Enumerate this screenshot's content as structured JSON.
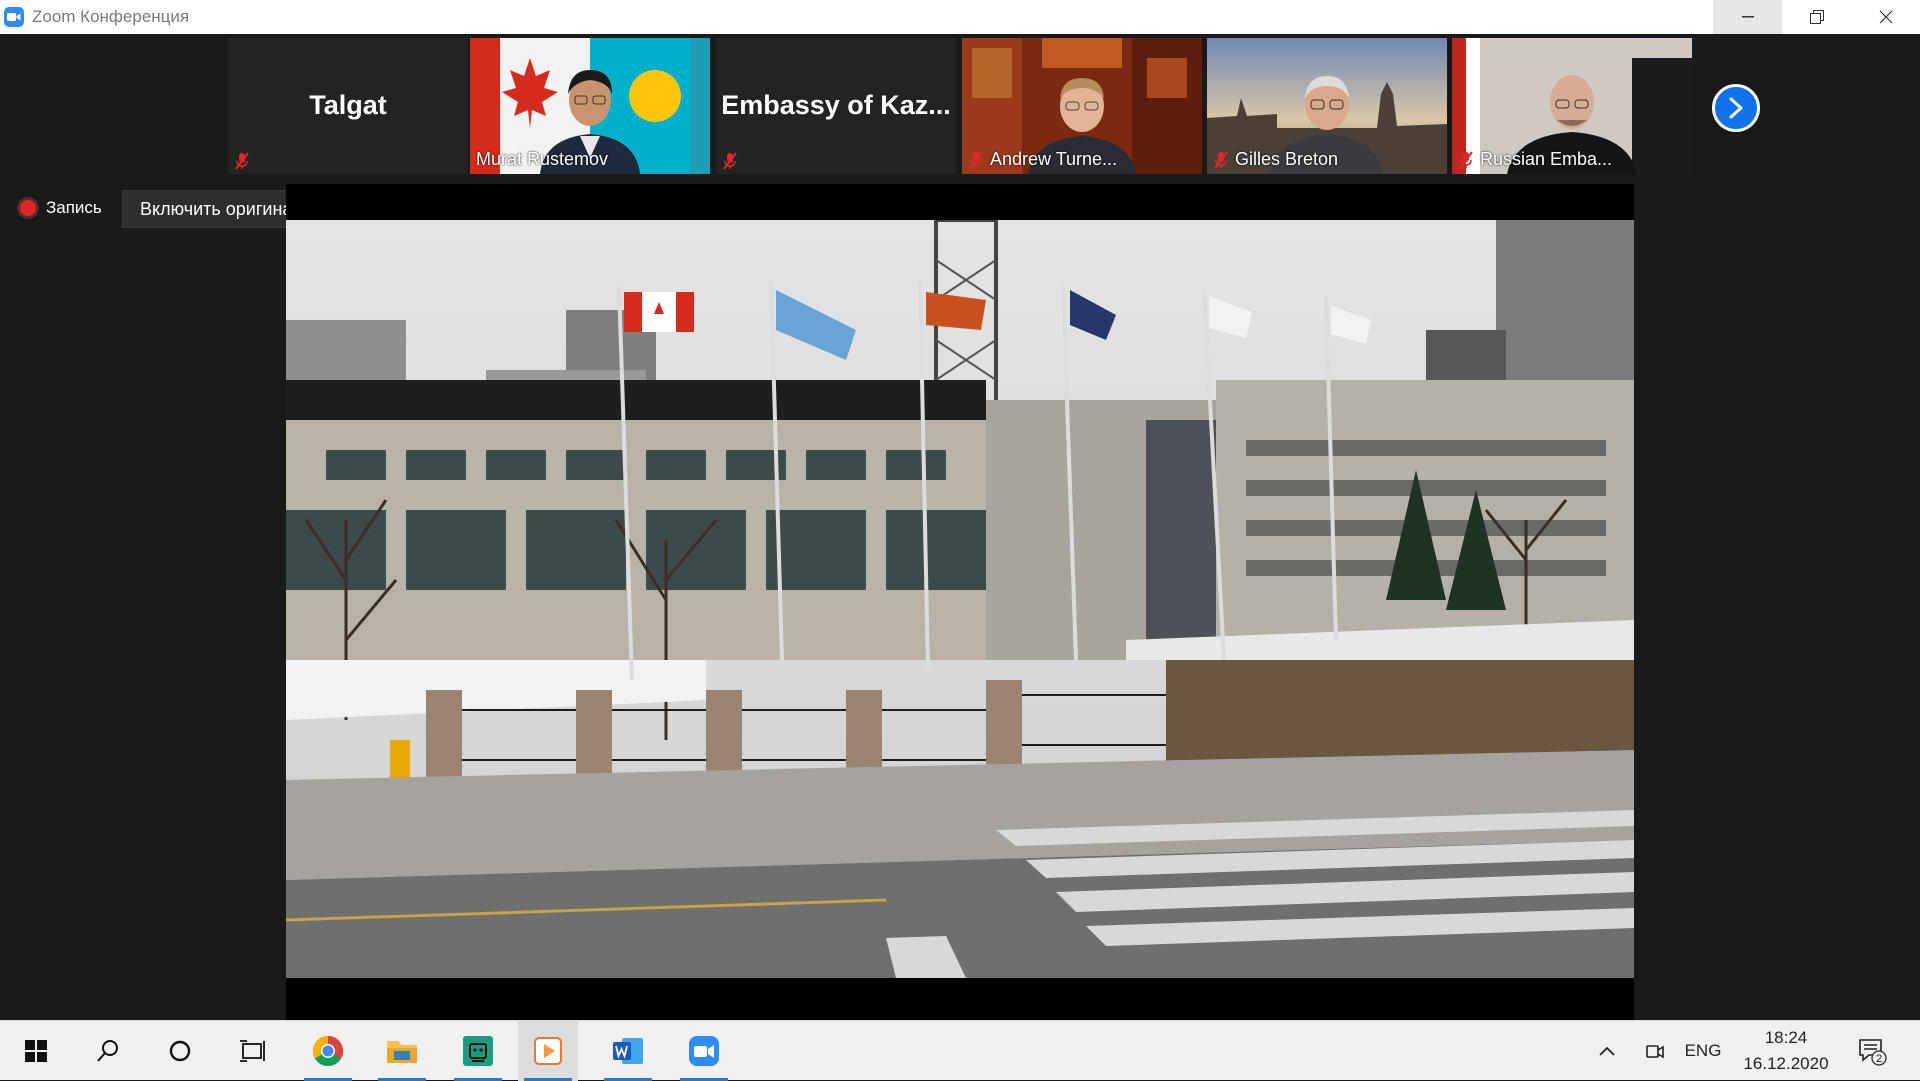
{
  "window": {
    "title": "Zoom Конференция"
  },
  "participants": [
    {
      "name": "Talgat",
      "display": "name",
      "muted": true
    },
    {
      "name": "Murat Rustemov",
      "display": "video",
      "muted": false,
      "active_speaker": true
    },
    {
      "name": "Embassy  of  Kaz...",
      "display": "name",
      "muted": true
    },
    {
      "name": "Andrew Turne...",
      "display": "video",
      "muted": true
    },
    {
      "name": "Gilles Breton",
      "display": "video",
      "muted": true
    },
    {
      "name": "Russian Emba...",
      "display": "video",
      "muted": true
    }
  ],
  "recording": {
    "label": "Запись"
  },
  "original_sound": {
    "label": "Включить оригинальный звук"
  },
  "tray": {
    "language": "ENG",
    "notifications": "2"
  },
  "clock": {
    "time": "18:24",
    "date": "16.12.2020"
  },
  "colors": {
    "zoom_blue": "#2d8cff",
    "active_border": "#8bc34a",
    "record_red": "#e02828",
    "taskbar_accent": "#2b78c4"
  }
}
